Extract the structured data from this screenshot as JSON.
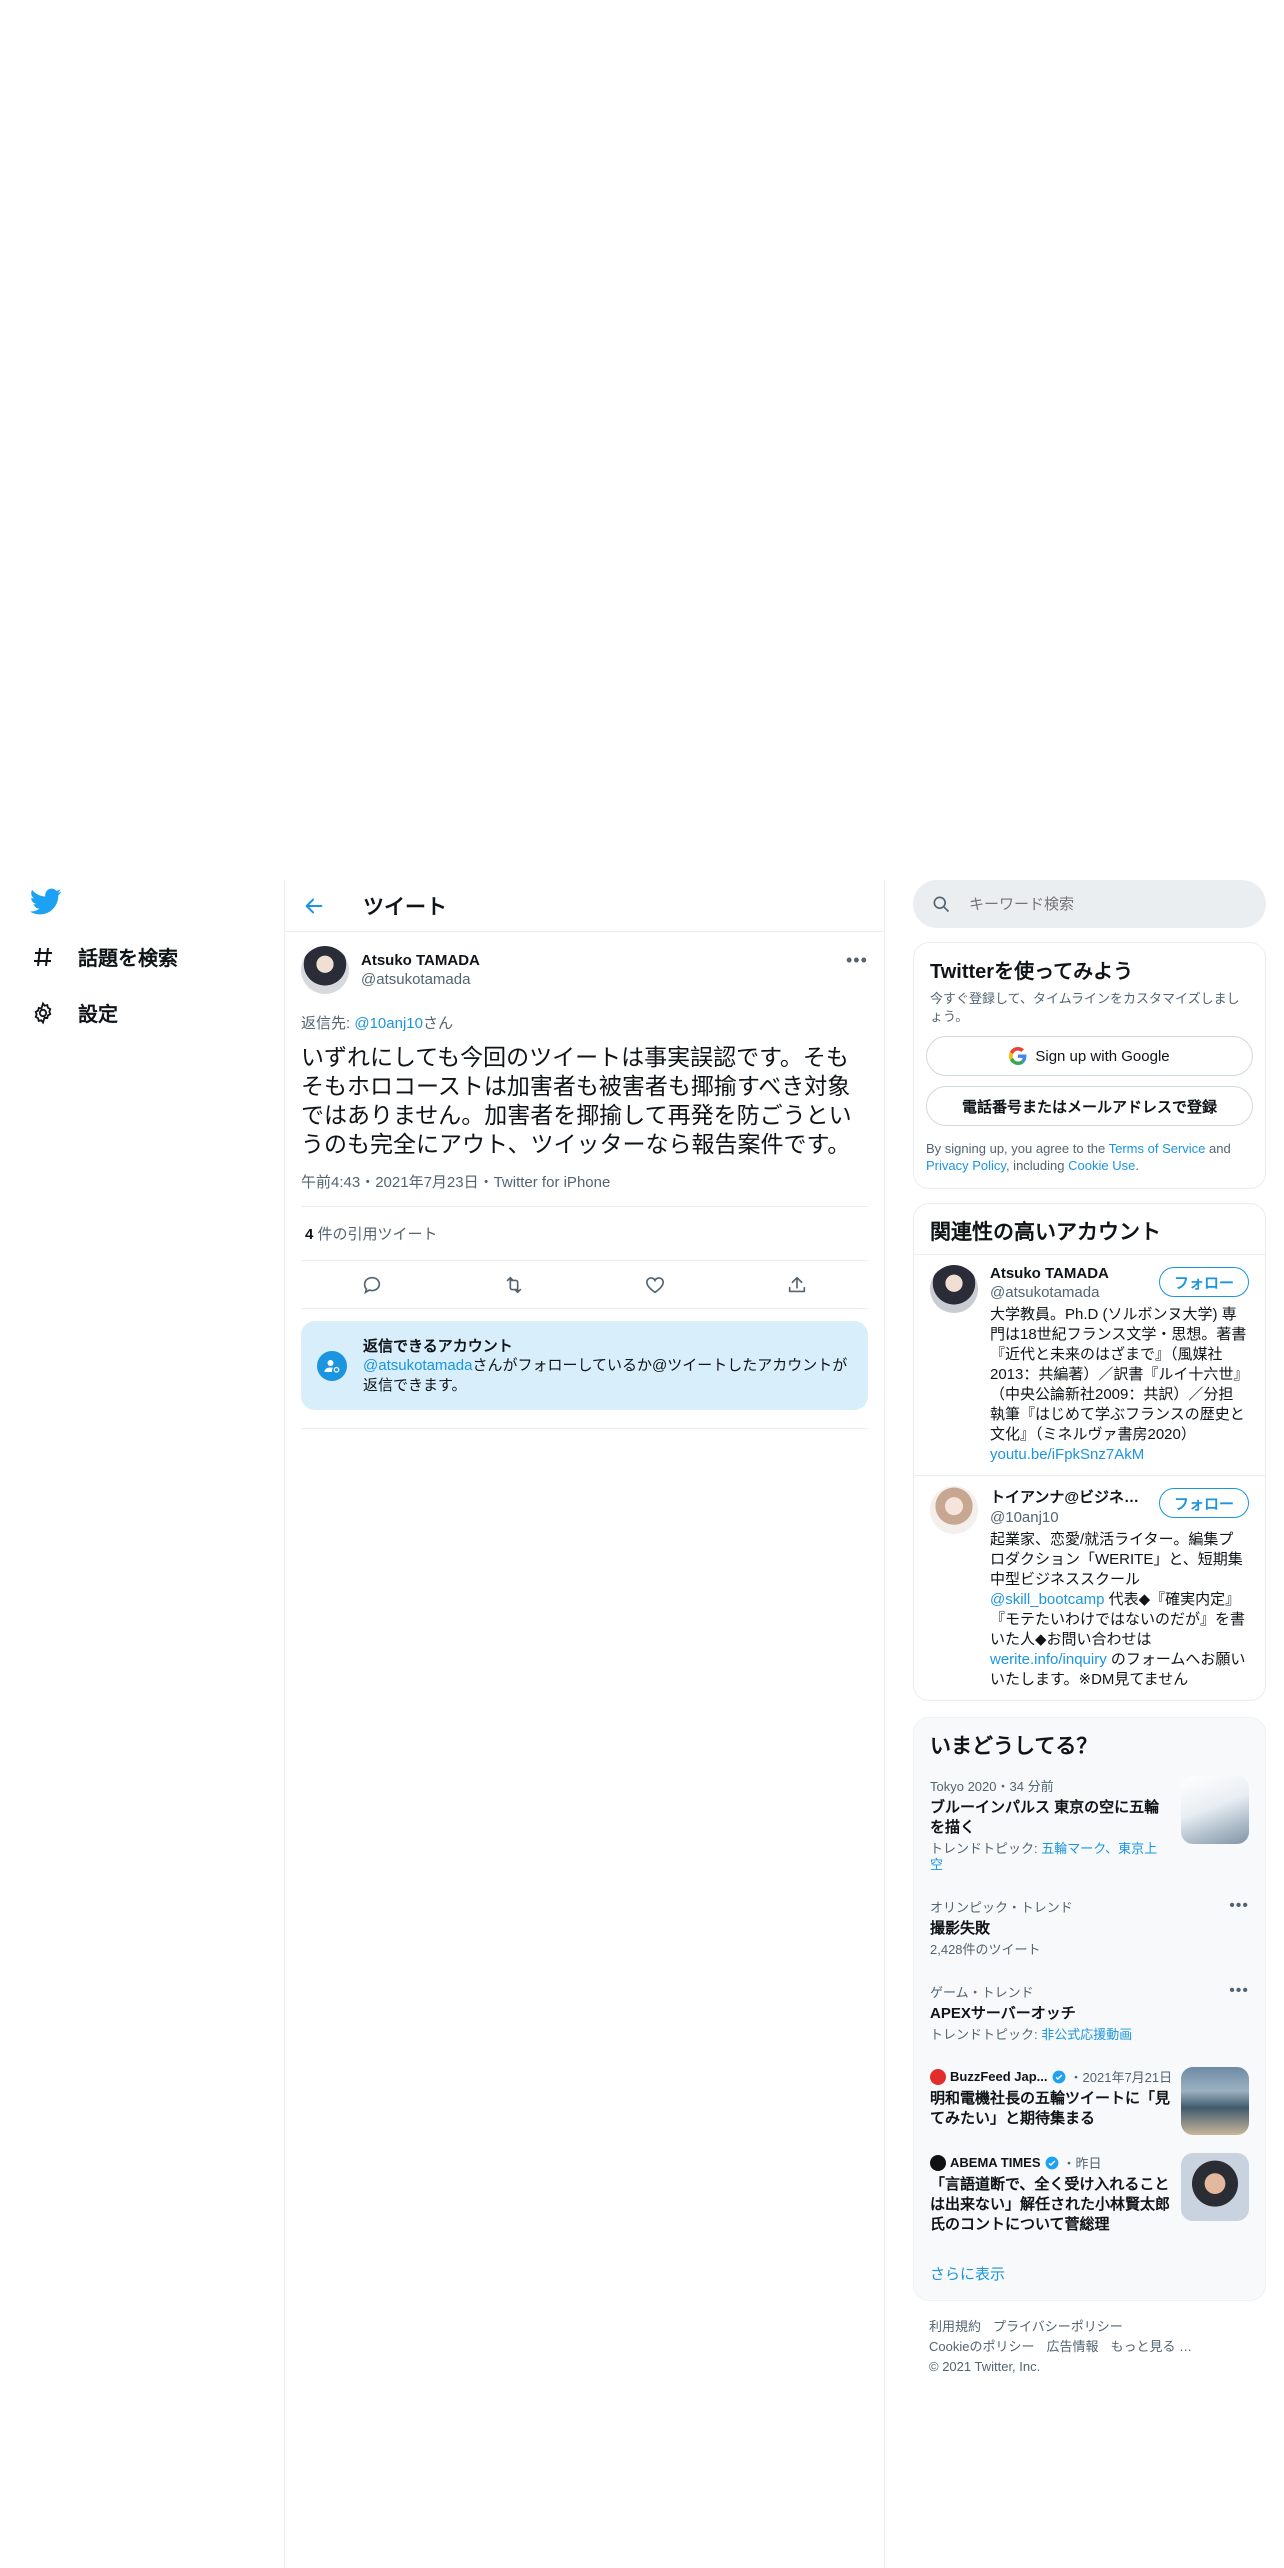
{
  "nav": {
    "logo": "twitter-bird-icon",
    "explore_label": "話題を検索",
    "settings_label": "設定"
  },
  "header": {
    "title": "ツイート"
  },
  "tweet": {
    "display_name": "Atsuko TAMADA",
    "handle": "@atsukotamada",
    "reply_prefix": "返信先: ",
    "reply_to": "@10anj10",
    "reply_suffix": "さん",
    "text": "いずれにしても今回のツイートは事実誤認です。そもそもホロコーストは加害者も被害者も揶揄すべき対象ではありません。加害者を揶揄して再発を防ごうというのも完全にアウト、ツイッターなら報告案件です。",
    "meta": "午前4:43・2021年7月23日・Twitter for iPhone",
    "quote_count": "4",
    "quote_label": " 件の引用ツイート"
  },
  "reply_box": {
    "title": "返信できるアカウント",
    "handle": "@atsukotamada",
    "text": "さんがフォローしているか@ツイートしたアカウントが返信できます。"
  },
  "search": {
    "placeholder": "キーワード検索"
  },
  "signup": {
    "title": "Twitterを使ってみよう",
    "subtitle": "今すぐ登録して、タイムラインをカスタマイズしましょう。",
    "google_label": "Sign up with Google",
    "phone_label": "電話番号またはメールアドレスで登録",
    "terms_pre": "By signing up, you agree to the ",
    "terms_link": "Terms of Service",
    "terms_mid": " and ",
    "privacy_link": "Privacy Policy",
    "terms_mid2": ", including ",
    "cookie_link": "Cookie Use",
    "terms_end": "."
  },
  "related": {
    "title": "関連性の高いアカウント",
    "follow_label": "フォロー",
    "accounts": [
      {
        "name": "Atsuko TAMADA",
        "handle": "@atsukotamada",
        "bio": "大学教員。Ph.D (ソルボンヌ大学) 専門は18世紀フランス文学・思想。著書『近代と未来のはざまで』（風媒社2013：共編著）／訳書『ルイ十六世』（中央公論新社2009：共訳）／分担執筆『はじめて学ぶフランスの歴史と文化』（ミネルヴァ書房2020）",
        "link": "youtu.be/iFpkSnz7AkM"
      },
      {
        "name": "トイアンナ@ビジネスマ…",
        "handle": "@10anj10",
        "bio1": "起業家、恋愛/就活ライター。編集プロダクション「WERITE」と、短期集中型ビジネススクール ",
        "bio_link1": "@skill_bootcamp",
        "bio2": " 代表◆『確実内定』『モテたいわけではないのだが』を書いた人◆お問い合わせは ",
        "bio_link2": "werite.info/inquiry",
        "bio3": " のフォームへお願いいたします。※DM見てません"
      }
    ]
  },
  "trends": {
    "title": "いまどうしてる？",
    "items": [
      {
        "context": "Tokyo 2020・34 分前",
        "name": "ブルーインパルス 東京の空に五輪を描く",
        "sub_prefix": "トレンドトピック: ",
        "sub_links": "五輪マーク、東京上空"
      },
      {
        "context": "オリンピック・トレンド",
        "name": "撮影失敗",
        "sub": "2,428件のツイート"
      },
      {
        "context": "ゲーム・トレンド",
        "name": "APEXサーバーオッチ",
        "sub_prefix": "トレンドトピック: ",
        "sub_links": "非公式応援動画"
      },
      {
        "source": "BuzzFeed Jap...",
        "date": "・2021年7月21日",
        "name": "明和電機社長の五輪ツイートに「見てみたい」と期待集まる"
      },
      {
        "source": "ABEMA TIMES",
        "date": "・昨日",
        "name": "「言語道断で、全く受け入れることは出来ない」解任された小林賢太郎氏のコントについて菅総理"
      }
    ],
    "show_more": "さらに表示"
  },
  "footer": {
    "terms": "利用規約",
    "privacy": "プライバシーポリシー",
    "cookie": "Cookieのポリシー",
    "ads": "広告情報",
    "more": "もっと見る …",
    "copyright": "© 2021 Twitter, Inc."
  },
  "colors": {
    "accent": "#1b95e0",
    "reply_bg": "#d8eefb"
  }
}
